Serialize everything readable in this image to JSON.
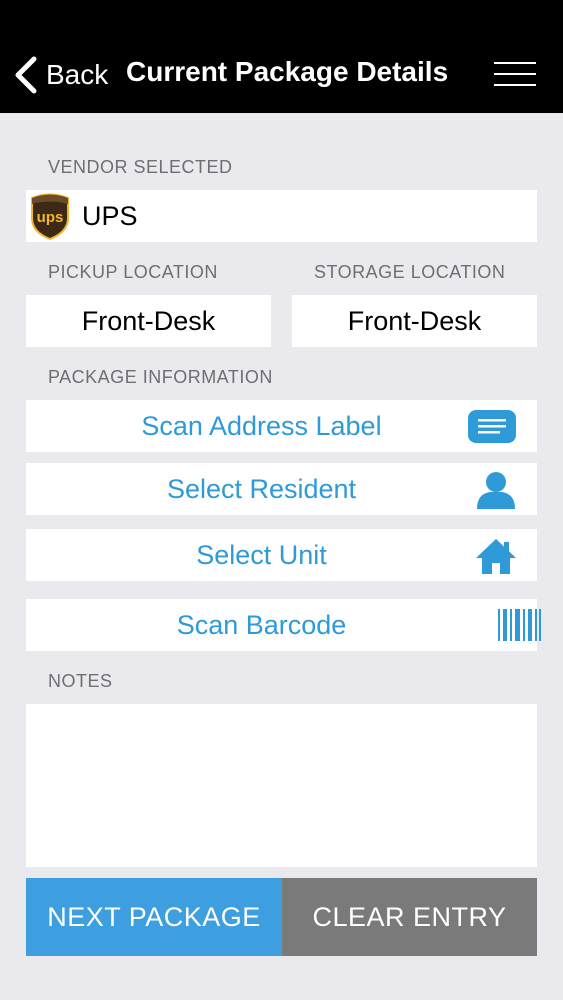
{
  "header": {
    "back_label": "Back",
    "title": "Current Package Details",
    "icons": [
      "chevron-left-icon",
      "hamburger-menu-icon"
    ]
  },
  "vendor": {
    "section_label": "VENDOR SELECTED",
    "name": "UPS",
    "logo": "ups-logo",
    "logo_text": "ups"
  },
  "locations": {
    "pickup_label": "PICKUP LOCATION",
    "pickup_value": "Front-Desk",
    "storage_label": "STORAGE LOCATION",
    "storage_value": "Front-Desk"
  },
  "package_info": {
    "section_label": "PACKAGE INFORMATION",
    "actions": [
      {
        "label": "Scan Address Label",
        "icon": "address-label-icon"
      },
      {
        "label": "Select Resident",
        "icon": "person-icon"
      },
      {
        "label": "Select Unit",
        "icon": "home-icon"
      },
      {
        "label": "Scan Barcode",
        "icon": "barcode-icon"
      }
    ]
  },
  "notes": {
    "section_label": "NOTES",
    "value": ""
  },
  "footer": {
    "next_label": "NEXT PACKAGE",
    "clear_label": "CLEAR ENTRY"
  },
  "colors": {
    "accent": "#2e9ad8",
    "next_button": "#3d9ee0",
    "clear_button": "#7a7a7a",
    "background": "#e9e9ee",
    "navbar": "#000000"
  }
}
